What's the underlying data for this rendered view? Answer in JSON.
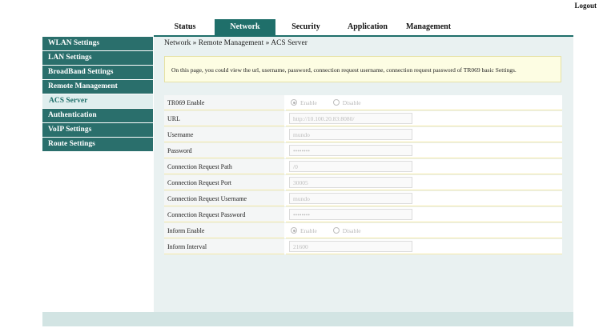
{
  "header": {
    "logout": "Logout"
  },
  "topnav": {
    "tabs": [
      {
        "label": "Status"
      },
      {
        "label": "Network",
        "active": true
      },
      {
        "label": "Security"
      },
      {
        "label": "Application"
      },
      {
        "label": "Management"
      }
    ]
  },
  "sidebar": {
    "items": [
      {
        "label": "WLAN Settings"
      },
      {
        "label": "LAN Settings"
      },
      {
        "label": "BroadBand Settings"
      },
      {
        "label": "Remote Management"
      },
      {
        "label": "ACS Server",
        "sub": true,
        "active": true
      },
      {
        "label": "Authentication"
      },
      {
        "label": "VoIP Settings"
      },
      {
        "label": "Route Settings"
      }
    ]
  },
  "main": {
    "breadcrumb": "Network » Remote Management » ACS Server",
    "info": "On this page, you could view the url, username, password, connection request username, connection request password of TR069 basic Settings.",
    "fields": {
      "tr069_enable": {
        "label": "TR069 Enable",
        "option_enable": "Enable",
        "option_disable": "Disable",
        "selected": "Enable"
      },
      "url": {
        "label": "URL",
        "value": "http://10.100.20.83:8080/"
      },
      "username": {
        "label": "Username",
        "value": "mundo"
      },
      "password": {
        "label": "Password",
        "value": "••••••••"
      },
      "conn_req_path": {
        "label": "Connection Request Path",
        "value": "/0"
      },
      "conn_req_port": {
        "label": "Connection Request Port",
        "value": "30005"
      },
      "conn_req_username": {
        "label": "Connection Request Username",
        "value": "mundo"
      },
      "conn_req_password": {
        "label": "Connection Request Password",
        "value": "••••••••"
      },
      "inform_enable": {
        "label": "Inform Enable",
        "option_enable": "Enable",
        "option_disable": "Disable",
        "selected": "Enable"
      },
      "inform_interval": {
        "label": "Inform Interval",
        "value": "21600"
      }
    }
  },
  "colors": {
    "accent": "#1f6f6a",
    "sidebar": "#2a6f6c",
    "panel": "#e9f1f1",
    "info_bg": "#fdfde3"
  }
}
